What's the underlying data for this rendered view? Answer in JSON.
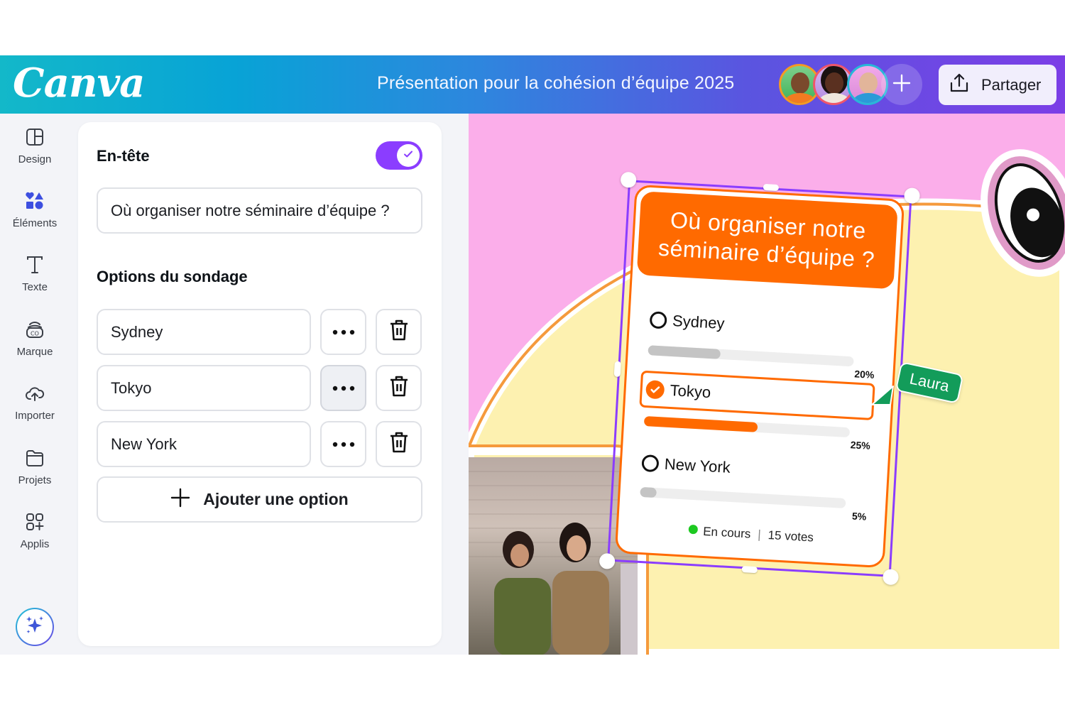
{
  "header": {
    "logo": "Canva",
    "document_title": "Présentation pour la cohésion d’équipe 2025",
    "collaborators": [
      {
        "name": "collaborator-1",
        "ring_color": "#f59a23"
      },
      {
        "name": "collaborator-2",
        "ring_color": "#f0566a"
      },
      {
        "name": "collaborator-3",
        "ring_color": "#27b7d8"
      }
    ],
    "add_collaborator_icon": "plus-icon",
    "share_label": "Partager",
    "share_icon": "upload-icon"
  },
  "sidebar": {
    "items": [
      {
        "label": "Design",
        "icon": "layout-icon"
      },
      {
        "label": "Éléments",
        "icon": "shapes-icon"
      },
      {
        "label": "Texte",
        "icon": "text-icon"
      },
      {
        "label": "Marque",
        "icon": "brand-icon"
      },
      {
        "label": "Importer",
        "icon": "cloud-upload-icon"
      },
      {
        "label": "Projets",
        "icon": "folder-icon"
      },
      {
        "label": "Applis",
        "icon": "apps-icon"
      }
    ],
    "magic_icon": "sparkle-icon"
  },
  "panel": {
    "header_section_label": "En-tête",
    "header_toggle_on": true,
    "header_value": "Où organiser notre séminaire d’équipe ?",
    "options_section_label": "Options du sondage",
    "options": [
      {
        "value": "Sydney"
      },
      {
        "value": "Tokyo"
      },
      {
        "value": "New York"
      }
    ],
    "add_option_label": "Ajouter une option"
  },
  "poll": {
    "question": "Où organiser notre séminaire d’équipe ?",
    "options": [
      {
        "label": "Sydney",
        "percent_label": "20%",
        "fill_fraction": 0.35,
        "selected": false
      },
      {
        "label": "Tokyo",
        "percent_label": "25%",
        "fill_fraction": 0.55,
        "selected": true
      },
      {
        "label": "New York",
        "percent_label": "5%",
        "fill_fraction": 0.08,
        "selected": false
      }
    ],
    "status": "En cours",
    "votes": "15 votes"
  },
  "cursor": {
    "user": "Laura"
  },
  "colors": {
    "accent_purple": "#8b3dff",
    "poll_orange": "#ff6a00",
    "cursor_green": "#139c5a",
    "status_green": "#1dc921",
    "canvas_pink": "#fbaeea",
    "canvas_yellow": "#fdf1b0"
  }
}
